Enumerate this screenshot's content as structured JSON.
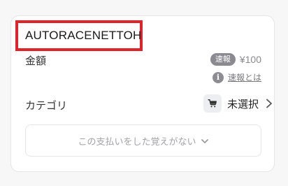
{
  "merchant": {
    "name": "AUTORACENETTOH",
    "highlight_color": "#e0222b"
  },
  "amount": {
    "label": "金額",
    "badge": "速報",
    "value": "¥100"
  },
  "help": {
    "icon": "info-icon",
    "link_label": "速報とは"
  },
  "category": {
    "label": "カテゴリ",
    "icon": "cart-icon",
    "value": "未選択"
  },
  "dispute": {
    "label": "この支払いをした覚えがない",
    "icon": "chevron-down-icon"
  }
}
